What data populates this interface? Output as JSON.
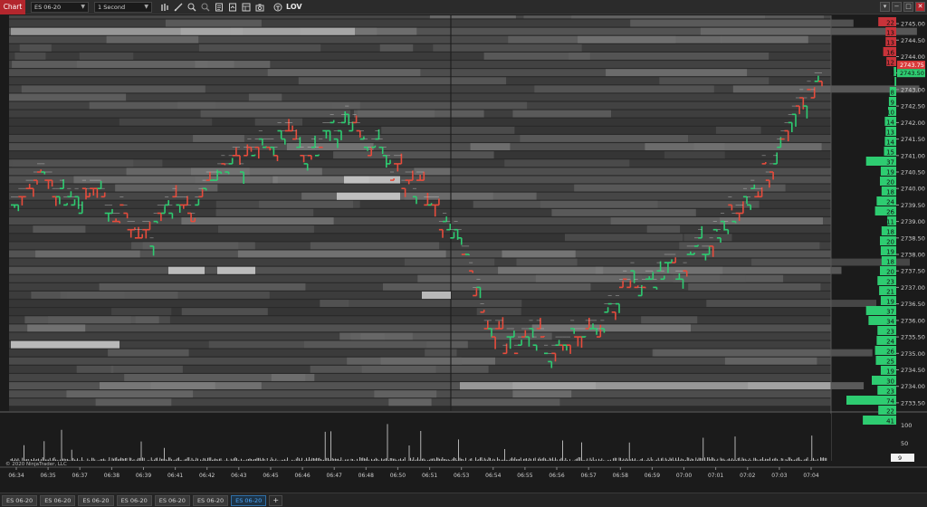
{
  "toolbar": {
    "chart_tab": "Chart",
    "instrument": "ES 06-20",
    "interval": "1 Second",
    "indicator_label": "LOV",
    "icons": [
      "bar-type-icon",
      "drawing-tool-icon",
      "zoom-icon",
      "zoom-out-icon",
      "properties-icon",
      "strategies-icon",
      "data-box-icon",
      "snapshot-icon"
    ],
    "window_buttons": [
      "▾",
      "−",
      "□",
      "✕"
    ]
  },
  "chart_data": {
    "type": "line",
    "instrument": "ES 06-20",
    "interval": "1 Second",
    "y_ticks": [
      "2745.00",
      "2744.50",
      "2744.00",
      "2743.50",
      "2743.00",
      "2742.50",
      "2742.00",
      "2741.50",
      "2741.00",
      "2740.50",
      "2740.00",
      "2739.50",
      "2739.00",
      "2738.50",
      "2738.00",
      "2737.50",
      "2737.00",
      "2736.50",
      "2736.00",
      "2735.50",
      "2735.00",
      "2734.50",
      "2734.00",
      "2733.50"
    ],
    "ylim": [
      2733.25,
      2745.25
    ],
    "x_ticks": [
      "06:34",
      "06:35",
      "06:37",
      "06:38",
      "06:39",
      "06:41",
      "06:42",
      "06:43",
      "06:45",
      "06:46",
      "06:47",
      "06:48",
      "06:50",
      "06:51",
      "06:53",
      "06:54",
      "06:55",
      "06:56",
      "06:57",
      "06:58",
      "06:59",
      "07:00",
      "07:01",
      "07:02",
      "07:03",
      "07:04"
    ],
    "price_path": [
      [
        0,
        2739.5
      ],
      [
        1,
        2740.5
      ],
      [
        2,
        2739.75
      ],
      [
        3,
        2739.5
      ],
      [
        4,
        2739.75
      ],
      [
        5,
        2739.0
      ],
      [
        6,
        2738.5
      ],
      [
        7,
        2739.5
      ],
      [
        8,
        2739.25
      ],
      [
        9,
        2740.5
      ],
      [
        10,
        2740.75
      ],
      [
        11,
        2741.25
      ],
      [
        12,
        2741.5
      ],
      [
        13,
        2741.0
      ],
      [
        14,
        2741.75
      ],
      [
        15,
        2742.0
      ],
      [
        16,
        2741.25
      ],
      [
        17,
        2740.5
      ],
      [
        18,
        2740.0
      ],
      [
        19,
        2739.0
      ],
      [
        20,
        2738.25
      ],
      [
        21,
        2736.0
      ],
      [
        22,
        2735.25
      ],
      [
        23,
        2735.5
      ],
      [
        24,
        2735.0
      ],
      [
        25,
        2735.75
      ],
      [
        26,
        2735.5
      ],
      [
        27,
        2737.25
      ],
      [
        28,
        2737.0
      ],
      [
        29,
        2737.5
      ],
      [
        30,
        2737.75
      ],
      [
        31,
        2738.5
      ],
      [
        32,
        2739.25
      ],
      [
        33,
        2740.0
      ],
      [
        34,
        2741.0
      ],
      [
        35,
        2742.5
      ],
      [
        36,
        2743.5
      ]
    ],
    "last_price": "2743.75",
    "bid_price": "2743.50",
    "volume_ticks": [
      "100",
      "50"
    ],
    "volume_last": "9",
    "dom_sizes": [
      "22",
      "13",
      "13",
      "16",
      "12",
      "3",
      "2",
      "8",
      "9",
      "10",
      "14",
      "13",
      "14",
      "15",
      "37",
      "19",
      "20",
      "18",
      "24",
      "26",
      "11",
      "18",
      "20",
      "19",
      "18",
      "20",
      "23",
      "21",
      "19",
      "37",
      "34",
      "23",
      "24",
      "26",
      "25",
      "19",
      "30",
      "23",
      "74",
      "22",
      "41"
    ],
    "grid": false
  },
  "copyright": "© 2020 NinjaTrader, LLC",
  "tabs": [
    "ES 06-20",
    "ES 06-20",
    "ES 06-20",
    "ES 06-20",
    "ES 06-20",
    "ES 06-20",
    "ES 06-20"
  ],
  "active_tab_index": 6,
  "add_tab": "+",
  "colors": {
    "up": "#2ecc71",
    "down": "#e74c3c",
    "ask_label": "#d93a3a",
    "bid_label": "#2ecc71",
    "background": "#1c1c1c"
  }
}
